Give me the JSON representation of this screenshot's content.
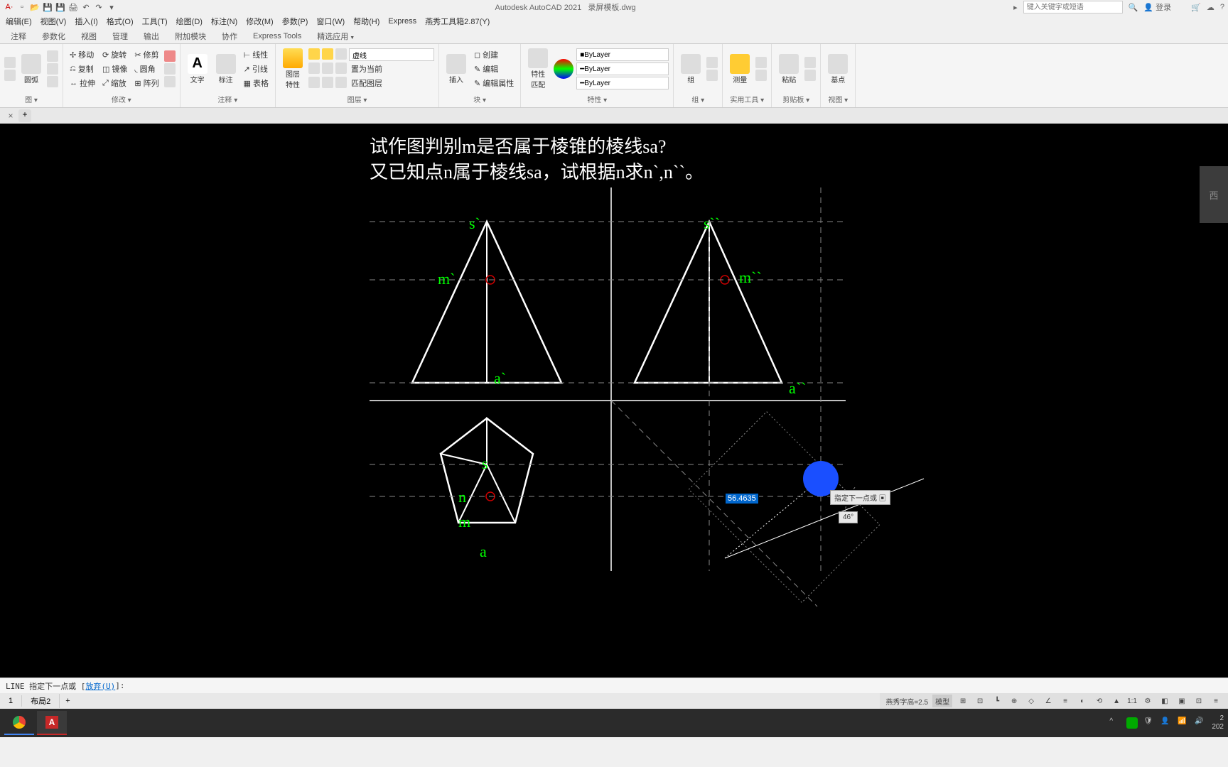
{
  "title": {
    "app": "Autodesk AutoCAD 2021",
    "file": "录屏模板.dwg"
  },
  "qat": [
    "A",
    "new",
    "open",
    "save",
    "saveas",
    "print",
    "undo",
    "redo"
  ],
  "search_placeholder": "键入关键字或短语",
  "login": "登录",
  "menus": [
    "编辑(E)",
    "视图(V)",
    "插入(I)",
    "格式(O)",
    "工具(T)",
    "绘图(D)",
    "标注(N)",
    "修改(M)",
    "参数(P)",
    "窗口(W)",
    "帮助(H)",
    "Express",
    "燕秀工具箱2.87(Y)"
  ],
  "ribbon_tabs": [
    "注释",
    "参数化",
    "视图",
    "管理",
    "输出",
    "附加模块",
    "协作",
    "Express Tools",
    "精选应用"
  ],
  "ribbon": {
    "draw": {
      "label": "图 ▾",
      "arc": "圆弧"
    },
    "modify": {
      "label": "修改 ▾",
      "move": "移动",
      "rotate": "旋转",
      "trim": "修剪",
      "copy": "复制",
      "mirror": "镜像",
      "fillet": "圆角",
      "stretch": "拉伸",
      "scale": "缩放",
      "array": "阵列"
    },
    "annot": {
      "label": "注释 ▾",
      "text": "文字",
      "dim": "标注",
      "line": "线性",
      "leader": "引线",
      "table": "表格"
    },
    "layers": {
      "label": "图层 ▾",
      "props": "图层\n特性",
      "current": "虚线",
      "b1": "置为当前",
      "b2": "匹配图层"
    },
    "block": {
      "label": "块 ▾",
      "insert": "插入",
      "create": "创建",
      "edit": "编辑",
      "editattr": "编辑属性"
    },
    "props": {
      "label": "特性 ▾",
      "match": "特性\n匹配",
      "v1": "ByLayer",
      "v2": "ByLayer",
      "v3": "ByLayer"
    },
    "group": {
      "label": "组 ▾",
      "g": "组"
    },
    "util": {
      "label": "实用工具 ▾",
      "measure": "测量"
    },
    "clip": {
      "label": "剪贴板 ▾",
      "paste": "粘贴"
    },
    "view": {
      "label": "视图 ▾",
      "base": "基点"
    }
  },
  "canvas": {
    "q1": "试作图判别m是否属于棱锥的棱线sa?",
    "q2": "又已知点n属于棱线sa，试根据n求n`,n``。",
    "labels": {
      "s1": "s`",
      "s2": "s``",
      "m1": "m`",
      "m2": "m``",
      "a1": "a`",
      "a2": "a``",
      "s": "s",
      "n": "n",
      "m": "m",
      "a": "a"
    },
    "viewcube": "西",
    "dyn_val": "56.4635",
    "dyn_hint": "指定下一点或",
    "dyn_angle": "46°"
  },
  "cmd": {
    "prefix": "LINE 指定下一点或 [",
    "undo": "放弃(U)",
    "suffix": "]:"
  },
  "layout": {
    "l1": "1",
    "l2": "布局2",
    "add": "+"
  },
  "status": {
    "yx": "燕秀字高=2.5",
    "model": "模型",
    "scale": "1:1"
  },
  "taskbar": {
    "time": "2",
    "date": "202"
  }
}
